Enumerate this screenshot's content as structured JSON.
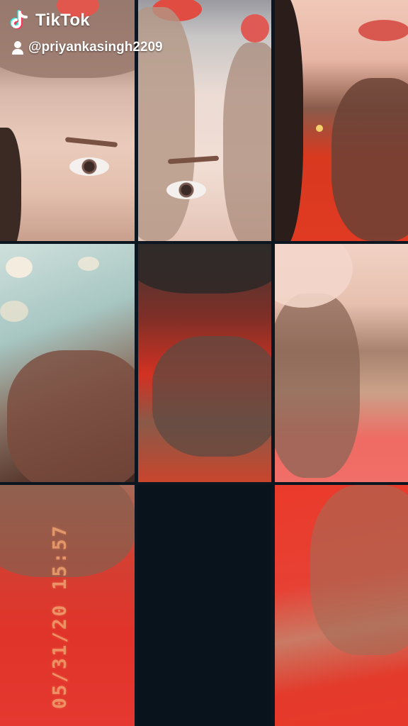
{
  "watermark": {
    "brand": "TikTok",
    "username": "@priyankasingh2209",
    "brand_icon": "tiktok-note-icon",
    "user_icon": "person-icon"
  },
  "timestamp_overlay": {
    "text": "05/31/20  15:57",
    "color": "#f0a270"
  },
  "grid": {
    "rows": 3,
    "columns": 3,
    "tiles": [
      {
        "content": "face-left-eye"
      },
      {
        "content": "face-right-eye"
      },
      {
        "content": "lips-and-neck"
      },
      {
        "content": "background-and-hair"
      },
      {
        "content": "hair-and-red-shirt"
      },
      {
        "content": "cheek-and-hair"
      },
      {
        "content": "red-shirt-and-hair"
      },
      {
        "content": "empty-black"
      },
      {
        "content": "red-shirt-and-hair"
      }
    ]
  }
}
